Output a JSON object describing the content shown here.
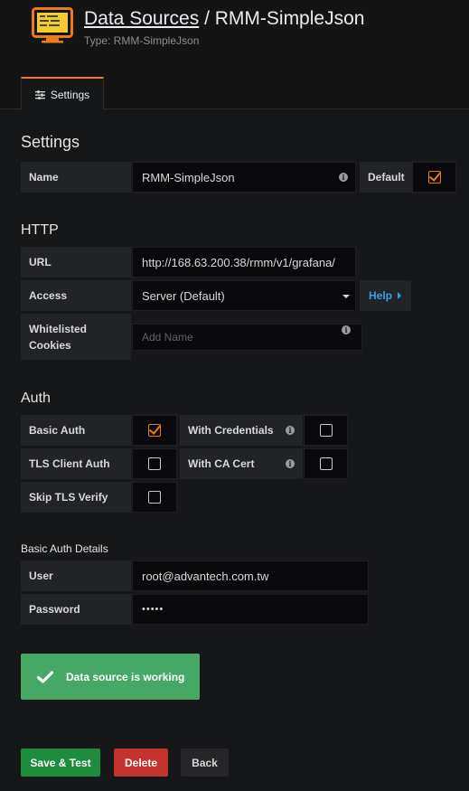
{
  "header": {
    "title_link": "Data Sources",
    "title_separator": " / ",
    "title_name": "RMM-SimpleJson",
    "subtitle": "Type: RMM-SimpleJson",
    "logo_icon": "server-icon"
  },
  "tabs": [
    {
      "label": "Settings",
      "icon": "sliders-icon",
      "active": true
    }
  ],
  "settings": {
    "title": "Settings",
    "name_label": "Name",
    "name_value": "RMM-SimpleJson",
    "default_label": "Default",
    "default_checked": true
  },
  "http": {
    "title": "HTTP",
    "url_label": "URL",
    "url_value": "http://168.63.200.38/rmm/v1/grafana/",
    "access_label": "Access",
    "access_value": "Server (Default)",
    "help_label": "Help",
    "cookies_label_line1": "Whitelisted",
    "cookies_label_line2": "Cookies",
    "cookies_placeholder": "Add Name"
  },
  "auth": {
    "title": "Auth",
    "basic_auth_label": "Basic Auth",
    "basic_auth_checked": true,
    "with_credentials_label": "With Credentials",
    "with_credentials_checked": false,
    "tls_client_auth_label": "TLS Client Auth",
    "tls_client_auth_checked": false,
    "with_ca_cert_label": "With CA Cert",
    "with_ca_cert_checked": false,
    "skip_tls_label": "Skip TLS Verify",
    "skip_tls_checked": false
  },
  "basic_auth_details": {
    "title": "Basic Auth Details",
    "user_label": "User",
    "user_value": "root@advantech.com.tw",
    "password_label": "Password",
    "password_value": "•••••"
  },
  "alert": {
    "message": "Data source is working",
    "icon": "check-icon"
  },
  "actions": {
    "save_label": "Save & Test",
    "delete_label": "Delete",
    "back_label": "Back"
  },
  "colors": {
    "accent": "#eb7b18",
    "success": "#47a866",
    "save": "#1f8b3d",
    "danger": "#c4332e",
    "link": "#33a2e5"
  }
}
